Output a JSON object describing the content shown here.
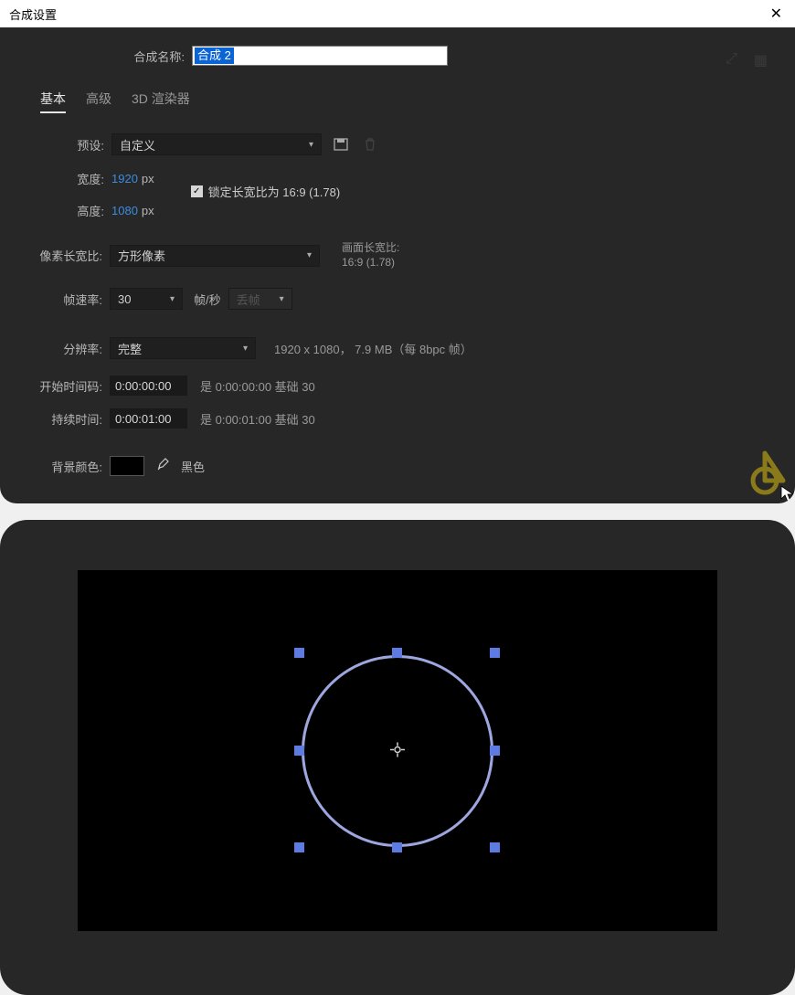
{
  "dialog": {
    "title": "合成设置",
    "comp_name_label": "合成名称:",
    "comp_name_value": "合成 2",
    "tabs": {
      "basic": "基本",
      "advanced": "高级",
      "renderer": "3D 渲染器"
    },
    "preset": {
      "label": "预设:",
      "value": "自定义"
    },
    "width": {
      "label": "宽度:",
      "value": "1920",
      "unit": "px"
    },
    "height": {
      "label": "高度:",
      "value": "1080",
      "unit": "px"
    },
    "lock_aspect": "锁定长宽比为 16:9 (1.78)",
    "par": {
      "label": "像素长宽比:",
      "value": "方形像素",
      "info1": "画面长宽比:",
      "info2": "16:9 (1.78)"
    },
    "fps": {
      "label": "帧速率:",
      "value": "30",
      "unit_label": "帧/秒",
      "basis": "丢帧"
    },
    "res": {
      "label": "分辨率:",
      "value": "完整",
      "info": "1920 x 1080， 7.9 MB（每 8bpc 帧）"
    },
    "start": {
      "label": "开始时间码:",
      "value": "0:00:00:00",
      "suffix": "是 0:00:00:00 基础 30"
    },
    "dur": {
      "label": "持续时间:",
      "value": "0:00:01:00",
      "suffix": "是 0:00:01:00 基础 30"
    },
    "bg": {
      "label": "背景颜色:",
      "name": "黑色",
      "hex": "#000000"
    }
  },
  "viewport": {
    "shape": "ellipse",
    "stroke": "#9ea6df",
    "handle_color": "#5d7be0"
  }
}
